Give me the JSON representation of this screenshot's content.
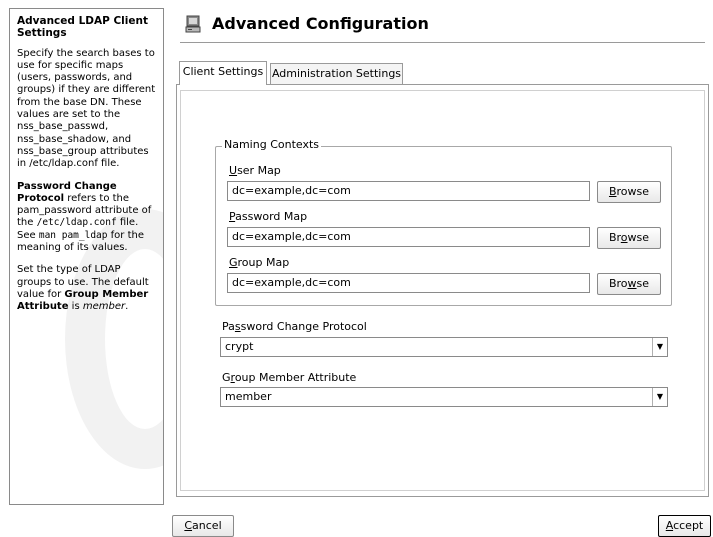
{
  "help": {
    "title": "Advanced LDAP Client Settings",
    "para1": "Specify the search bases to use for specific maps (users, passwords, and groups) if they are different from the base DN. These values are set to the nss_base_passwd, nss_base_shadow, and nss_base_group attributes in /etc/ldap.conf file.",
    "para2_bold": "Password Change Protocol",
    "para2_a": " refers to the pam_password attribute of the ",
    "para2_code1": "/etc/ldap.conf",
    "para2_b": " file. See ",
    "para2_code2": "man pam_ldap",
    "para2_c": " for the meaning of its values.",
    "para3_a": "Set the type of LDAP groups to use. The default value for ",
    "para3_bold": "Group Member Attribute",
    "para3_b": " is ",
    "para3_em": "member",
    "para3_c": "."
  },
  "header": {
    "title": "Advanced Configuration",
    "icon": "computer-config-icon"
  },
  "tabs": [
    {
      "label": "Client Settings",
      "active": true
    },
    {
      "label": "Administration Settings",
      "active": false
    }
  ],
  "naming_contexts": {
    "title": "Naming Contexts",
    "user_map": {
      "label_u": "U",
      "label_rest": "ser Map",
      "value": "dc=example,dc=com",
      "browse_a": "",
      "browse_u": "B",
      "browse_b": "rowse"
    },
    "password_map": {
      "label_u": "P",
      "label_rest": "assword Map",
      "value": "dc=example,dc=com",
      "browse_a": "Br",
      "browse_u": "o",
      "browse_b": "wse"
    },
    "group_map": {
      "label_u": "G",
      "label_rest": "roup Map",
      "value": "dc=example,dc=com",
      "browse_a": "Bro",
      "browse_u": "w",
      "browse_b": "se"
    }
  },
  "password_protocol": {
    "label_a": "Pa",
    "label_u": "s",
    "label_b": "sword Change Protocol",
    "value": "crypt"
  },
  "group_member": {
    "label_a": "G",
    "label_u": "r",
    "label_b": "oup Member Attribute",
    "value": "member"
  },
  "footer": {
    "cancel_u": "C",
    "cancel_rest": "ancel",
    "accept_u": "A",
    "accept_rest": "ccept"
  }
}
